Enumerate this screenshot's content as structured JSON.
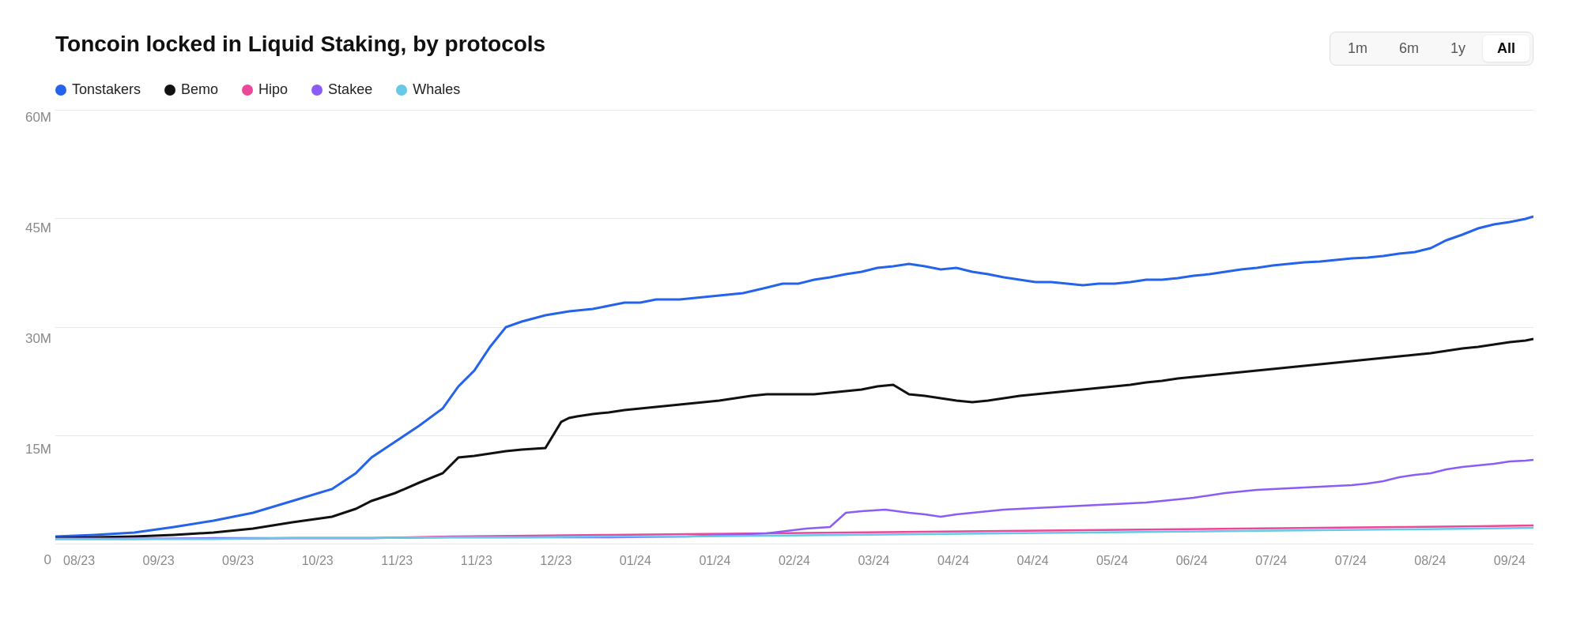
{
  "chart": {
    "title": "Toncoin locked in Liquid Staking, by protocols",
    "time_filters": [
      "1m",
      "6m",
      "1y",
      "All"
    ],
    "active_filter": "All",
    "legend": [
      {
        "label": "Tonstakers",
        "color": "#2563EB"
      },
      {
        "label": "Bemo",
        "color": "#111111"
      },
      {
        "label": "Hipo",
        "color": "#EC4899"
      },
      {
        "label": "Stakee",
        "color": "#8B5CF6"
      },
      {
        "label": "Whales",
        "color": "#67C8E8"
      }
    ],
    "y_axis": [
      "60M",
      "45M",
      "30M",
      "15M",
      "0"
    ],
    "x_axis": [
      "08/23",
      "09/23",
      "09/23",
      "10/23",
      "11/23",
      "11/23",
      "12/23",
      "01/24",
      "01/24",
      "02/24",
      "03/24",
      "04/24",
      "04/24",
      "05/24",
      "06/24",
      "07/24",
      "07/24",
      "08/24",
      "09/24"
    ]
  }
}
